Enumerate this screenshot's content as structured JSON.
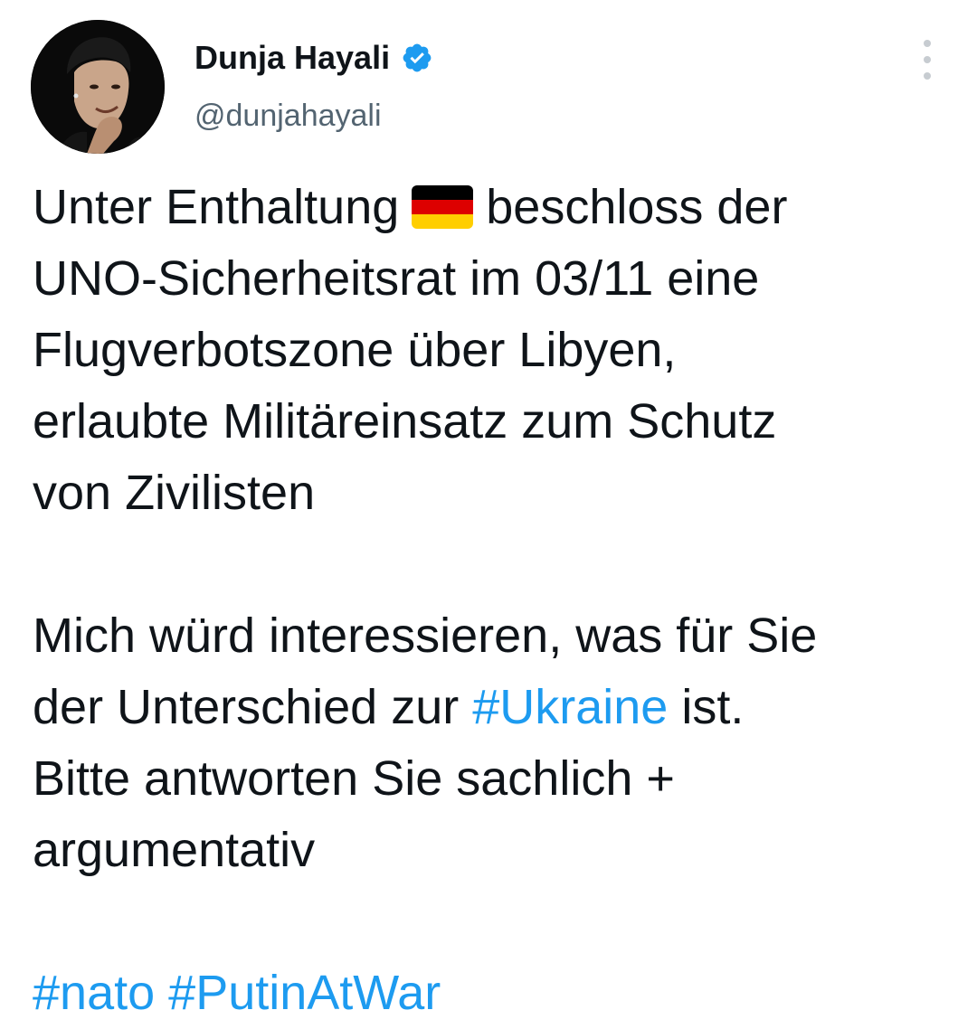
{
  "tweet": {
    "author": {
      "display_name": "Dunja Hayali",
      "handle": "@dunjahayali",
      "verified_icon": "verified-badge-icon",
      "avatar_icon": "profile-photo"
    },
    "menu_icon": "more-options-icon",
    "text": {
      "line1_before": "Unter Enthaltung",
      "flag_emoji": "🇩🇪",
      "flag_colors": [
        "#000000",
        "#dd0000",
        "#ffce00"
      ],
      "line1_after": "beschloss der",
      "line2": "UNO-Sicherheitsrat im 03/11 eine",
      "line3": "Flugverbotszone über Libyen,",
      "line4": "erlaubte Militäreinsatz zum Schutz",
      "line5": "von Zivilisten",
      "line6": "Mich würd interessieren, was für Sie",
      "line7_before": "der Unterschied zur ",
      "line7_hashtag": "#Ukraine",
      "line7_after": " ist.",
      "line8": "Bitte antworten Sie sachlich +",
      "line9": "argumentativ",
      "hashtag_nato": "#nato",
      "hashtag_putin": "#PutinAtWar"
    },
    "colors": {
      "text": "#0f1419",
      "secondary": "#536471",
      "link": "#1d9bf0",
      "verified": "#1d9bf0"
    }
  }
}
